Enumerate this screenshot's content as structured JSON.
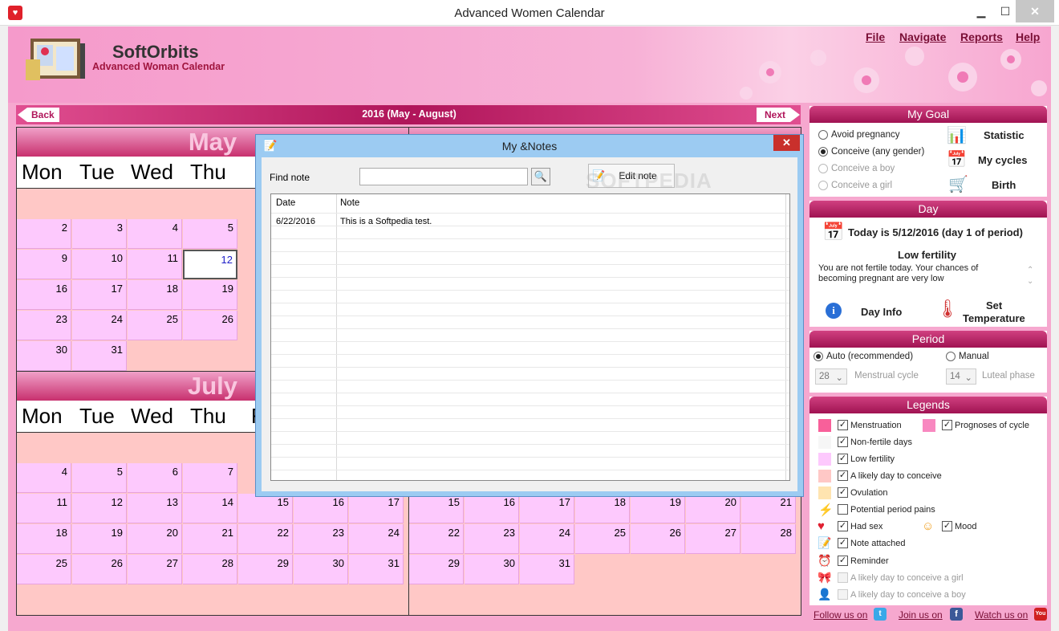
{
  "window": {
    "title": "Advanced Women Calendar"
  },
  "header": {
    "brand": "SoftOrbits",
    "product": "Advanced Woman Calendar"
  },
  "menu": {
    "file": "File",
    "navigate": "Navigate",
    "reports": "Reports",
    "help": "Help"
  },
  "nav": {
    "back": "Back",
    "next": "Next",
    "range": "2016 (May - August)"
  },
  "calendar": {
    "may": "May",
    "july": "July",
    "dow": [
      "Mon",
      "Tue",
      "Wed",
      "Thu"
    ],
    "dow_partial": "F",
    "may_rows": [
      [
        "2",
        "3",
        "4",
        "5"
      ],
      [
        "9",
        "10",
        "11",
        "12"
      ],
      [
        "16",
        "17",
        "18",
        "19"
      ],
      [
        "23",
        "24",
        "25",
        "26"
      ],
      [
        "30",
        "31"
      ]
    ],
    "july_rows": [
      [
        "4",
        "5",
        "6",
        "7"
      ],
      [
        "11",
        "12",
        "13",
        "14",
        "15",
        "16",
        "17"
      ],
      [
        "18",
        "19",
        "20",
        "21",
        "22",
        "23",
        "24"
      ],
      [
        "25",
        "26",
        "27",
        "28",
        "29",
        "30",
        "31"
      ]
    ],
    "august_rows": [
      [
        "15",
        "16",
        "17",
        "18",
        "19",
        "20",
        "21"
      ],
      [
        "22",
        "23",
        "24",
        "25",
        "26",
        "27",
        "28"
      ],
      [
        "29",
        "30",
        "31"
      ]
    ]
  },
  "notes_dialog": {
    "title": "My &Notes",
    "find_label": "Find note",
    "find_value": "",
    "edit_button": "Edit note",
    "col_date": "Date",
    "col_note": "Note",
    "rows": [
      {
        "date": "6/22/2016",
        "note": "This is a Softpedia test."
      }
    ],
    "watermark": "SOFTPEDIA"
  },
  "goal": {
    "header": "My Goal",
    "options": [
      "Avoid pregnancy",
      "Conceive (any gender)",
      "Conceive a boy",
      "Conceive a girl"
    ],
    "buttons": [
      "Statistic",
      "My cycles",
      "Birth"
    ]
  },
  "day": {
    "header": "Day",
    "today": "Today is 5/12/2016 (day 1 of period)",
    "fertility": "Low fertility",
    "description": "You are not fertile today. Your chances of becoming pregnant are very low",
    "day_info": "Day Info",
    "set_temp_1": "Set",
    "set_temp_2": "Temperature"
  },
  "period": {
    "header": "Period",
    "auto": "Auto (recommended)",
    "manual": "Manual",
    "cycle_value": "28",
    "cycle_label": "Menstrual cycle",
    "luteal_value": "14",
    "luteal_label": "Luteal phase"
  },
  "legends": {
    "header": "Legends",
    "items": [
      "Menstruation",
      "Prognoses of cycle",
      "Non-fertile days",
      "Low fertility",
      "A likely day to conceive",
      "Ovulation",
      "Potential period pains",
      "Had sex",
      "Mood",
      "Note attached",
      "Reminder",
      "A likely day to conceive a girl",
      "A likely day to conceive a boy"
    ]
  },
  "footer": {
    "follow": "Follow us on",
    "join": "Join us on",
    "watch": "Watch us on"
  },
  "colors": {
    "menstruation": "#f8609a",
    "prognoses": "#f888c0",
    "nonfertile": "#f6f6f6",
    "low": "#fdc9fd",
    "likely": "#ffc8c6",
    "ovulation": "#ffe4b0"
  }
}
